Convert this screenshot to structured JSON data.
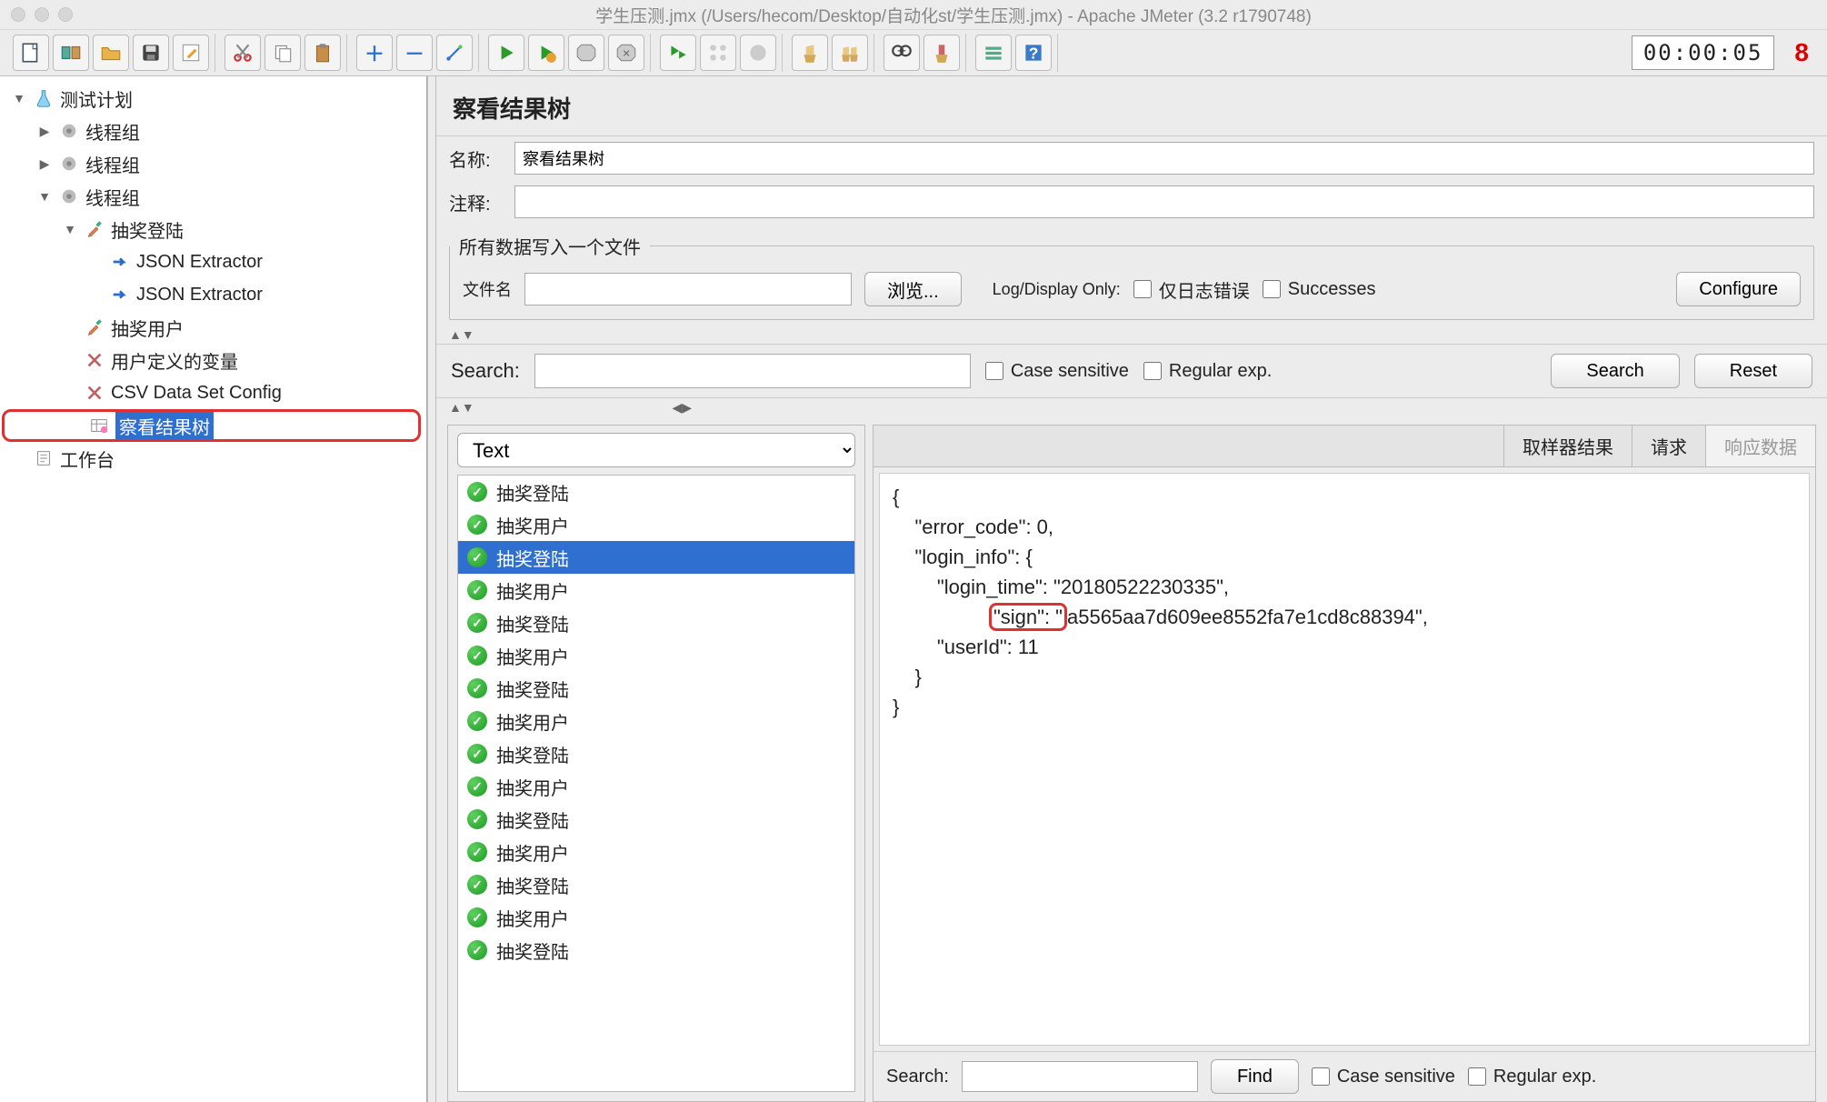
{
  "window": {
    "title": "学生压测.jmx (/Users/hecom/Desktop/自动化st/学生压测.jmx) - Apache JMeter (3.2 r1790748)"
  },
  "timer": {
    "value": "00:00:05",
    "warnings": "8"
  },
  "tree": {
    "root": "测试计划",
    "thread_group": "线程组",
    "sampler_login": "抽奖登陆",
    "json_extractor": "JSON Extractor",
    "sampler_user": "抽奖用户",
    "user_vars": "用户定义的变量",
    "csv": "CSV Data Set Config",
    "view_results_tree": "察看结果树",
    "workbench": "工作台"
  },
  "panel": {
    "title": "察看结果树",
    "name_label": "名称:",
    "name_value": "察看结果树",
    "comment_label": "注释:"
  },
  "filewrite": {
    "legend": "所有数据写入一个文件",
    "filename_label": "文件名",
    "filename_value": "",
    "browse": "浏览...",
    "logdisplay": "Log/Display Only:",
    "errors_only": "仅日志错误",
    "successes": "Successes",
    "configure": "Configure"
  },
  "search": {
    "label": "Search:",
    "value": "",
    "case_sensitive": "Case sensitive",
    "regex": "Regular exp.",
    "search_btn": "Search",
    "reset_btn": "Reset"
  },
  "renderer": {
    "selected": "Text"
  },
  "results": [
    "抽奖登陆",
    "抽奖用户",
    "抽奖登陆",
    "抽奖用户",
    "抽奖登陆",
    "抽奖用户",
    "抽奖登陆",
    "抽奖用户",
    "抽奖登陆",
    "抽奖用户",
    "抽奖登陆",
    "抽奖用户",
    "抽奖登陆",
    "抽奖用户",
    "抽奖登陆"
  ],
  "results_selected_index": 2,
  "tabs": {
    "sampler": "取样器结果",
    "request": "请求",
    "response": "响应数据"
  },
  "response": {
    "line1": "{",
    "line2": "    \"error_code\": 0,",
    "line3": "    \"login_info\": {",
    "line4": "        \"login_time\": \"20180522230335\",",
    "sign_key": "\"sign\": \"",
    "sign_val": "a5565aa7d609ee8552fa7e1cd8c88394\",",
    "line6": "        \"userId\": 11",
    "line7": "    }",
    "line8": "}"
  },
  "bottom_search": {
    "label": "Search:",
    "find": "Find",
    "case_sensitive": "Case sensitive",
    "regex": "Regular exp."
  }
}
